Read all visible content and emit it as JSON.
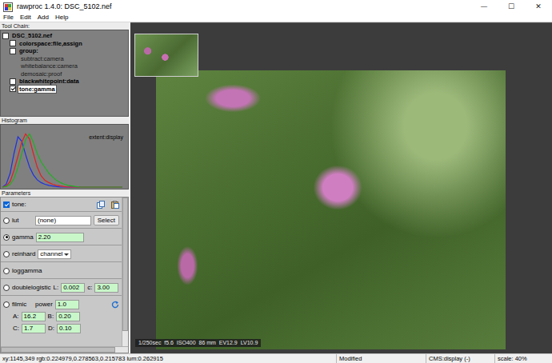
{
  "window": {
    "title": "rawproc 1.4.0: DSC_5102.nef",
    "controls": [
      "—",
      "☐",
      "✕"
    ]
  },
  "menu": [
    "File",
    "Edit",
    "Add",
    "Help"
  ],
  "toolchain": {
    "header": "Tool Chain:",
    "image": {
      "label": "DSC_5102.nef",
      "checked": false,
      "selected": false
    },
    "tools": [
      {
        "label": "colorspace:file,assign",
        "checked": false,
        "selected": false,
        "steps": []
      },
      {
        "label": "group:",
        "checked": false,
        "selected": false,
        "steps": [
          {
            "label": "subtract:camera",
            "selected": false
          },
          {
            "label": "whitebalance:camera",
            "selected": false
          },
          {
            "label": "demosaic:proof",
            "selected": false
          }
        ]
      },
      {
        "label": "blackwhitepoint:data",
        "checked": false,
        "selected": false,
        "steps": []
      },
      {
        "label": "tone:gamma",
        "checked": true,
        "selected": true,
        "steps": []
      }
    ]
  },
  "histogram": {
    "header": "Histogram",
    "extent": "extent:display",
    "series": [
      {
        "color": "#2030e0",
        "values": [
          0,
          0.05,
          0.25,
          0.6,
          0.9,
          0.82,
          0.58,
          0.36,
          0.22,
          0.13,
          0.08,
          0.05,
          0.03,
          0.02,
          0.01,
          0,
          0,
          0,
          0,
          0,
          0,
          0,
          0,
          0,
          0,
          0,
          0,
          0,
          0,
          0,
          0,
          0
        ]
      },
      {
        "color": "#e02020",
        "values": [
          0,
          0.02,
          0.1,
          0.3,
          0.55,
          0.8,
          0.95,
          0.86,
          0.6,
          0.36,
          0.2,
          0.12,
          0.08,
          0.05,
          0.03,
          0.02,
          0.01,
          0,
          0,
          0,
          0,
          0,
          0,
          0,
          0,
          0,
          0,
          0,
          0,
          0,
          0,
          0
        ]
      },
      {
        "color": "#20b020",
        "values": [
          0,
          0.01,
          0.05,
          0.15,
          0.35,
          0.6,
          0.85,
          0.95,
          0.8,
          0.6,
          0.45,
          0.35,
          0.25,
          0.18,
          0.12,
          0.08,
          0.05,
          0.03,
          0.02,
          0.01,
          0,
          0,
          0,
          0,
          0,
          0,
          0,
          0,
          0,
          0,
          0,
          0
        ]
      }
    ]
  },
  "parameters": {
    "header": "Parameters",
    "tool": {
      "label": "tone:",
      "checked": true
    },
    "options": [
      {
        "label": "lut",
        "selected": false,
        "rows": [
          [
            {
              "kind": "text",
              "value": "(none)"
            },
            {
              "kind": "button",
              "label": "Select"
            }
          ]
        ]
      },
      {
        "label": "gamma",
        "selected": true,
        "rows": [
          [
            {
              "kind": "value",
              "value": "2.20"
            }
          ]
        ]
      },
      {
        "label": "reinhard",
        "selected": false,
        "rows": [
          [
            {
              "kind": "select",
              "value": "channel"
            }
          ]
        ]
      },
      {
        "label": "loggamma",
        "selected": false,
        "rows": [
          []
        ]
      },
      {
        "label": "doublelogistic",
        "selected": false,
        "rows": [
          [
            {
              "kind": "value",
              "prefix": "L:",
              "value": "0.002"
            },
            {
              "kind": "value",
              "prefix": "c:",
              "value": "3.00"
            }
          ]
        ]
      },
      {
        "label": "filmic",
        "selected": false,
        "rows": [
          [
            {
              "kind": "value",
              "prefix": "power",
              "value": "1.0"
            },
            {
              "kind": "reset"
            }
          ],
          [
            {
              "kind": "value",
              "prefix": "A:",
              "value": "16.2"
            },
            {
              "kind": "value",
              "prefix": "B:",
              "value": "0.20"
            }
          ],
          [
            {
              "kind": "value",
              "prefix": "C:",
              "value": "1.7"
            },
            {
              "kind": "value",
              "prefix": "D:",
              "value": "0.10"
            }
          ]
        ]
      }
    ],
    "scrollbars": {
      "vertical": {
        "level": 0.9
      },
      "horizontal": {
        "level": 0.9
      }
    }
  },
  "viewer": {
    "info": "1/250sec  f5.6  ISO400  86 mm  EV12.9  LV10.9"
  },
  "status_bar": [
    "xy:1145,349 rgb:0.224979,0.278563,0.215783 lum:0.262915",
    "Modified",
    "CMS:display (-)",
    "scale: 40%"
  ]
}
